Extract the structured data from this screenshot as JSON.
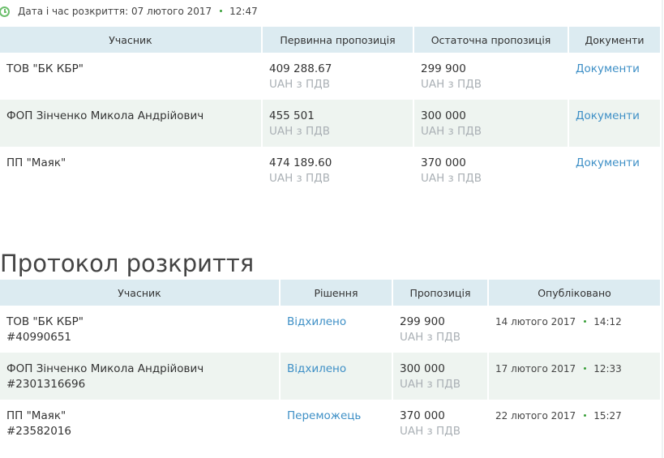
{
  "opening": {
    "label": "Дата і час розкриття: 07 лютого 2017",
    "time": "12:47"
  },
  "bids_table": {
    "headers": [
      "Учасник",
      "Первинна пропозиція",
      "Остаточна пропозиція",
      "Документи"
    ],
    "rows": [
      {
        "participant": "ТОВ \"БК КБР\"",
        "initial": "409 288.67",
        "initial_unit": "UAH з ПДВ",
        "final": "299 900",
        "final_unit": "UAH з ПДВ",
        "docs": "Документи"
      },
      {
        "participant": "ФОП Зінченко Микола Андрійович",
        "initial": "455 501",
        "initial_unit": "UAH з ПДВ",
        "final": "300 000",
        "final_unit": "UAH з ПДВ",
        "docs": "Документи"
      },
      {
        "participant": "ПП \"Маяк\"",
        "initial": "474 189.60",
        "initial_unit": "UAH з ПДВ",
        "final": "370 000",
        "final_unit": "UAH з ПДВ",
        "docs": "Документи"
      }
    ]
  },
  "protocol": {
    "title": "Протокол розкриття",
    "headers": [
      "Учасник",
      "Рішення",
      "Пропозиція",
      "Опубліковано"
    ],
    "rows": [
      {
        "participant": "ТОВ \"БК КБР\"",
        "id": "#40990651",
        "decision": "Відхилено",
        "offer": "299 900",
        "offer_unit": "UAH з ПДВ",
        "date": "14 лютого 2017",
        "time": "14:12"
      },
      {
        "participant": "ФОП Зінченко Микола Андрійович",
        "id": "#2301316696",
        "decision": "Відхилено",
        "offer": "300 000",
        "offer_unit": "UAH з ПДВ",
        "date": "17 лютого 2017",
        "time": "12:33"
      },
      {
        "participant": "ПП \"Маяк\"",
        "id": "#23582016",
        "decision": "Переможець",
        "offer": "370 000",
        "offer_unit": "UAH з ПДВ",
        "date": "22 лютого 2017",
        "time": "15:27"
      }
    ]
  },
  "colors": {
    "header_bg": "#dcebf1",
    "alt_row_bg": "#eef4f0",
    "link": "#3d8fc6",
    "muted": "#aab0b5",
    "clock": "#6dbf6d"
  }
}
